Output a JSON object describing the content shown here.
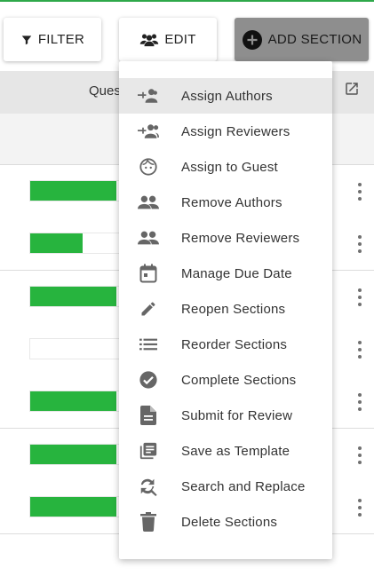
{
  "toolbar": {
    "filter_label": "FILTER",
    "edit_label": "EDIT",
    "add_section_label": "ADD SECTION"
  },
  "table": {
    "header_label": "Ques",
    "rows": [
      {
        "progress": 0.9
      },
      {
        "progress": 0.55
      },
      {
        "progress": 0.9
      },
      {
        "progress": 0.0
      },
      {
        "progress": 0.9
      },
      {
        "progress": 0.9
      },
      {
        "progress": 0.9
      }
    ]
  },
  "edit_menu": {
    "items": [
      {
        "label": "Assign Authors",
        "icon": "person-add-icon"
      },
      {
        "label": "Assign Reviewers",
        "icon": "group-add-icon"
      },
      {
        "label": "Assign to Guest",
        "icon": "guest-face-icon"
      },
      {
        "label": "Remove Authors",
        "icon": "people-icon"
      },
      {
        "label": "Remove Reviewers",
        "icon": "people-icon"
      },
      {
        "label": "Manage Due Date",
        "icon": "calendar-icon"
      },
      {
        "label": "Reopen Sections",
        "icon": "pencil-icon"
      },
      {
        "label": "Reorder Sections",
        "icon": "list-icon"
      },
      {
        "label": "Complete Sections",
        "icon": "check-circle-icon"
      },
      {
        "label": "Submit for Review",
        "icon": "document-icon"
      },
      {
        "label": "Save as Template",
        "icon": "library-books-icon"
      },
      {
        "label": "Search and Replace",
        "icon": "find-replace-icon"
      },
      {
        "label": "Delete Sections",
        "icon": "trash-icon"
      }
    ]
  },
  "colors": {
    "accent": "#2ea84a",
    "progress_fill": "#27b43e",
    "header_bg": "#e6e6e6",
    "icon": "#666666"
  }
}
